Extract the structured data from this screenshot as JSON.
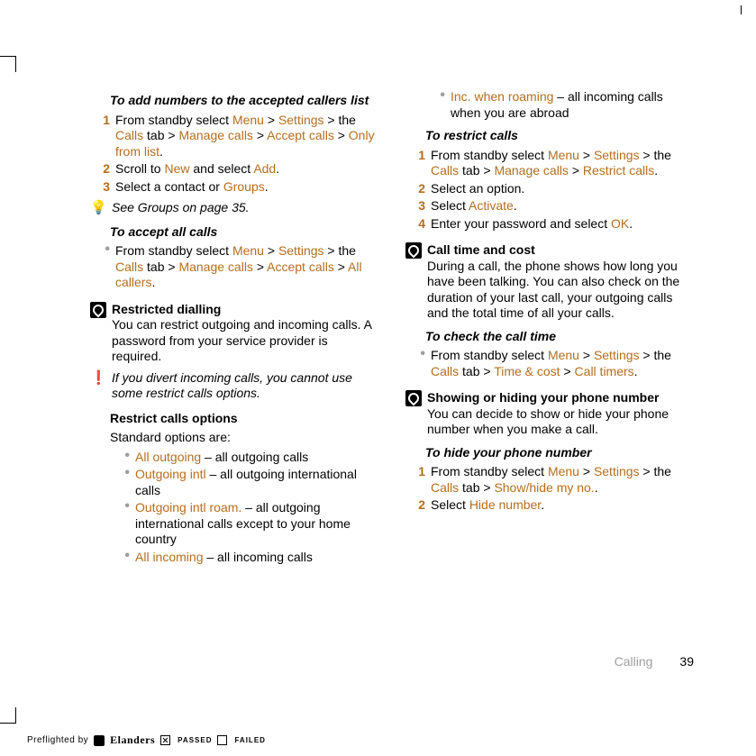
{
  "left": {
    "h1": "To add numbers to the accepted callers list",
    "s1_1a": "From standby select ",
    "s1_1_m1": "Menu",
    "s1_1b": " > ",
    "s1_1_m2": "Settings",
    "s1_1c": " > the ",
    "s1_1_m3": "Calls",
    "s1_1d": " tab > ",
    "s1_1_m4": "Manage calls",
    "s1_1e": " > ",
    "s1_1_m5": "Accept calls",
    "s1_1f": " > ",
    "s1_1_m6": "Only from list",
    "s1_1g": ".",
    "s1_2a": "Scroll to ",
    "s1_2_m1": "New",
    "s1_2b": " and select ",
    "s1_2_m2": "Add",
    "s1_2c": ".",
    "s1_3a": "Select a contact or ",
    "s1_3_m1": "Groups",
    "s1_3b": ".",
    "tip1": "See Groups on page 35.",
    "h2": "To accept all calls",
    "s2_1a": "From standby select ",
    "s2_1_m1": "Menu",
    "s2_1b": " > ",
    "s2_1_m2": "Settings",
    "s2_1c": " > the ",
    "s2_1_m3": "Calls",
    "s2_1d": " tab > ",
    "s2_1_m4": "Manage calls",
    "s2_1e": " > ",
    "s2_1_m5": "Accept calls",
    "s2_1f": " > ",
    "s2_1_m6": "All callers",
    "s2_1g": ".",
    "sect1_title": "Restricted dialling",
    "sect1_body": "You can restrict outgoing and incoming calls. A password from your service provider is required.",
    "tip2": "If you divert incoming calls, you cannot use some restrict calls options.",
    "h3": "Restrict calls options",
    "h3_sub": "Standard options are:",
    "opt1_m": "All outgoing",
    "opt1_t": " – all outgoing calls",
    "opt2_m": "Outgoing intl",
    "opt2_t": " – all outgoing international calls",
    "opt3_m": "Outgoing intl roam.",
    "opt3_t": " – all outgoing international calls except to your home country",
    "opt4_m": "All incoming",
    "opt4_t": " – all incoming calls"
  },
  "right": {
    "opt5_m": "Inc. when roaming",
    "opt5_t": " – all incoming calls when you are abroad",
    "h1": "To restrict calls",
    "s1_1a": "From standby select ",
    "s1_1_m1": "Menu",
    "s1_1b": " > ",
    "s1_1_m2": "Settings",
    "s1_1c": " > the ",
    "s1_1_m3": "Calls",
    "s1_1d": " tab > ",
    "s1_1_m4": "Manage calls",
    "s1_1e": " > ",
    "s1_1_m5": "Restrict calls",
    "s1_1f": ".",
    "s1_2": "Select an option.",
    "s1_3a": "Select ",
    "s1_3_m1": "Activate",
    "s1_3b": ".",
    "s1_4a": "Enter your password and select ",
    "s1_4_m1": "OK",
    "s1_4b": ".",
    "sect1_title": "Call time and cost",
    "sect1_body": "During a call, the phone shows how long you have been talking. You can also check on the duration of your last call, your outgoing calls and the total time of all your calls.",
    "h2": "To check the call time",
    "s2_1a": "From standby select ",
    "s2_1_m1": "Menu",
    "s2_1b": " > ",
    "s2_1_m2": "Settings",
    "s2_1c": " > the ",
    "s2_1_m3": "Calls",
    "s2_1d": " tab > ",
    "s2_1_m4": "Time & cost",
    "s2_1e": " > ",
    "s2_1_m5": "Call timers",
    "s2_1f": ".",
    "sect2_title": "Showing or hiding your phone number",
    "sect2_body": "You can decide to show or hide your phone number when you make a call.",
    "h3": "To hide your phone number",
    "s3_1a": "From standby select ",
    "s3_1_m1": "Menu",
    "s3_1b": " > ",
    "s3_1_m2": "Settings",
    "s3_1c": " > the ",
    "s3_1_m3": "Calls",
    "s3_1d": " tab > ",
    "s3_1_m4": "Show/hide my no.",
    "s3_1e": ".",
    "s3_2a": "Select ",
    "s3_2_m1": "Hide number",
    "s3_2b": "."
  },
  "nums": {
    "n1": "1",
    "n2": "2",
    "n3": "3",
    "n4": "4",
    "bullet": "•"
  },
  "footer": {
    "section": "Calling",
    "page": "39"
  },
  "preflight": {
    "by": "Preflighted by",
    "brand": "Elanders",
    "passed": "PASSED",
    "failed": "FAILED"
  }
}
